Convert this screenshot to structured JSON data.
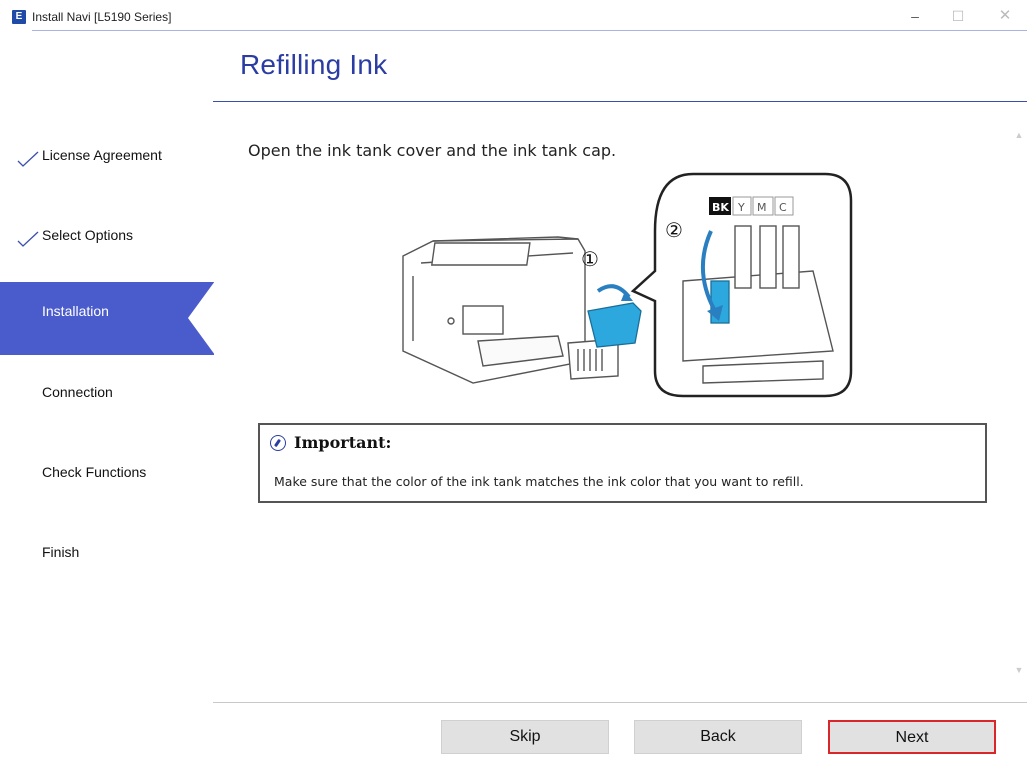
{
  "window": {
    "icon_letter": "E",
    "title": "Install Navi [L5190 Series]",
    "controls": {
      "minimize": "–",
      "maximize": "☐",
      "close": "✕"
    }
  },
  "header": {
    "title": "Refilling Ink"
  },
  "sidebar": {
    "accent_color": "#4a5bcb",
    "steps": [
      {
        "label": "License Agreement",
        "state": "done"
      },
      {
        "label": "Select Options",
        "state": "done"
      },
      {
        "label": "Installation",
        "state": "active"
      },
      {
        "label": "Connection",
        "state": "pending"
      },
      {
        "label": "Check Functions",
        "state": "pending"
      },
      {
        "label": "Finish",
        "state": "pending"
      }
    ]
  },
  "main": {
    "instruction": "Open the ink tank cover and the ink tank cap.",
    "illustration": {
      "step_markers": [
        "①",
        "②"
      ],
      "tank_labels": [
        "BK",
        "Y",
        "M",
        "C"
      ]
    },
    "important": {
      "title": "Important:",
      "text": "Make sure that the color of the ink tank matches the ink color that you want to refill."
    }
  },
  "footer": {
    "skip_label": "Skip",
    "back_label": "Back",
    "next_label": "Next",
    "highlight_color": "#d9262b"
  }
}
